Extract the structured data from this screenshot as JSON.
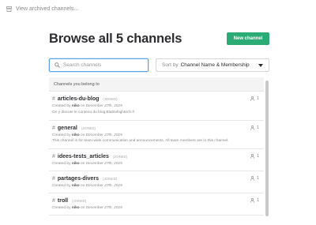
{
  "archived": {
    "label": "View archived channels..."
  },
  "title": "Browse all 5 channels",
  "new_channel_button": "New channel",
  "search": {
    "placeholder": "Search channels",
    "value": ""
  },
  "sort": {
    "prefix": "Sort by",
    "value": "Channel Name & Membership"
  },
  "section_header": "Channels you belong to",
  "channels": [
    {
      "hash": "#",
      "name": "articles-du-blog",
      "badge": "(JOINED)",
      "created_prefix": "Created by",
      "creator": "niko",
      "created_on": "on",
      "created_date": "December 27th, 2015",
      "description": "On y discute le contenu du blog Blablahightech.fr",
      "members": "1"
    },
    {
      "hash": "#",
      "name": "general",
      "badge": "(JOINED)",
      "created_prefix": "Created by",
      "creator": "niko",
      "created_on": "on",
      "created_date": "December 27th, 2015",
      "description": "This channel is for team-wide communication and announcements. All team members are in this channel.",
      "members": "1"
    },
    {
      "hash": "#",
      "name": "idees-tests_articles",
      "badge": "(JOINED)",
      "created_prefix": "Created by",
      "creator": "niko",
      "created_on": "on",
      "created_date": "December 27th, 2015",
      "description": "",
      "members": "1"
    },
    {
      "hash": "#",
      "name": "partages-divers",
      "badge": "(JOINED)",
      "created_prefix": "Created by",
      "creator": "niko",
      "created_on": "on",
      "created_date": "December 27th, 2015",
      "description": "",
      "members": "1"
    },
    {
      "hash": "#",
      "name": "troll",
      "badge": "(JOINED)",
      "created_prefix": "Created by",
      "creator": "niko",
      "created_on": "on",
      "created_date": "December 27th, 2015",
      "description": "",
      "members": "1"
    }
  ],
  "colors": {
    "accent": "#2bac76",
    "focus": "#5aa5e6"
  }
}
